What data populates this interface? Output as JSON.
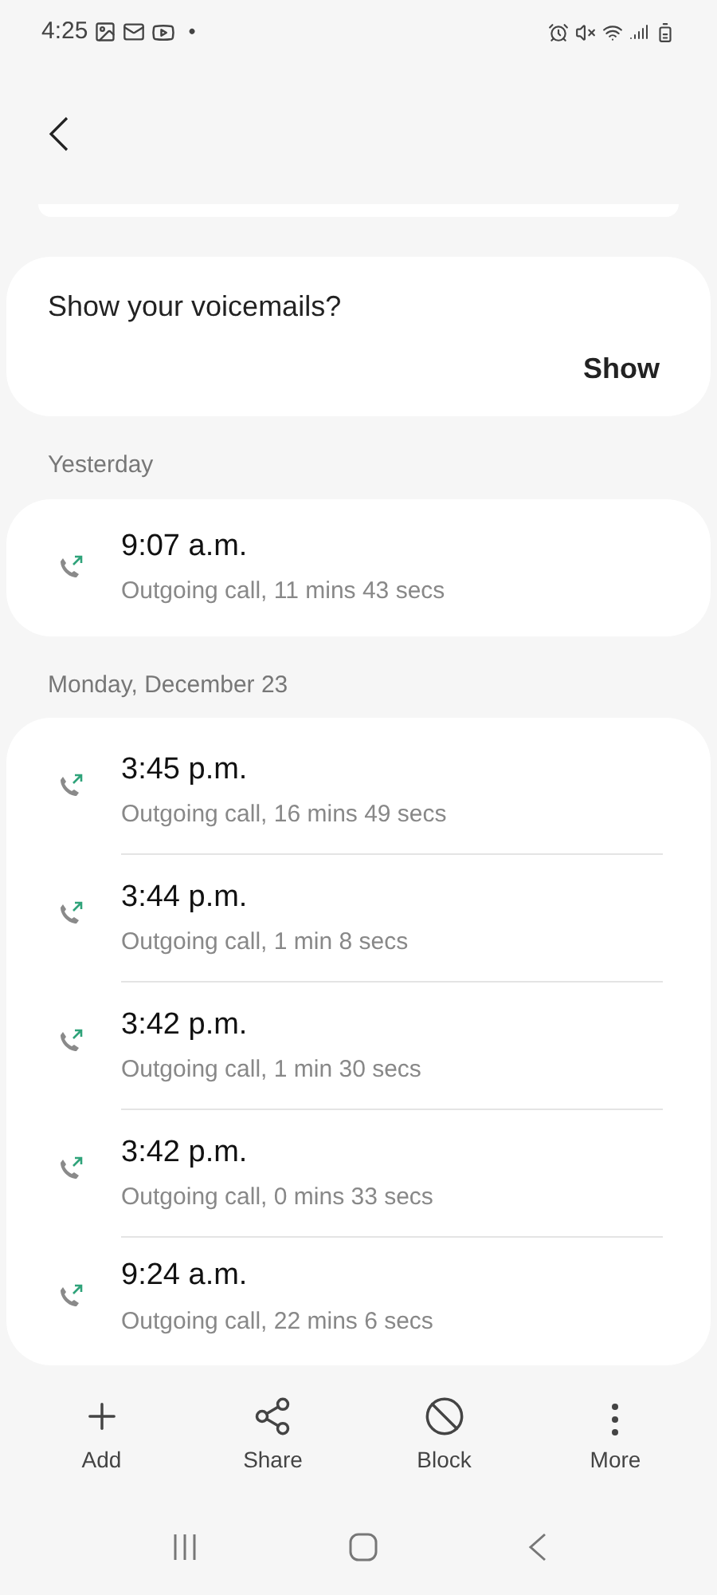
{
  "status_bar": {
    "time": "4:25",
    "dot": "•"
  },
  "voicemail_prompt": {
    "text": "Show your voicemails?",
    "action": "Show"
  },
  "groups": [
    {
      "date": "Yesterday",
      "calls": [
        {
          "time": "9:07 a.m.",
          "detail": "Outgoing call, 11 mins 43 secs"
        }
      ]
    },
    {
      "date": "Monday, December 23",
      "calls": [
        {
          "time": "3:45 p.m.",
          "detail": "Outgoing call, 16 mins 49 secs"
        },
        {
          "time": "3:44 p.m.",
          "detail": "Outgoing call, 1 min 8 secs"
        },
        {
          "time": "3:42 p.m.",
          "detail": "Outgoing call, 1 min 30 secs"
        },
        {
          "time": "3:42 p.m.",
          "detail": "Outgoing call, 0 mins 33 secs"
        },
        {
          "time": "9:24 a.m.",
          "detail": "Outgoing call, 22 mins 6 secs"
        }
      ]
    }
  ],
  "toolbar": [
    {
      "kind": "add",
      "label": "Add"
    },
    {
      "kind": "share",
      "label": "Share"
    },
    {
      "kind": "block",
      "label": "Block"
    },
    {
      "kind": "more",
      "label": "More"
    }
  ]
}
